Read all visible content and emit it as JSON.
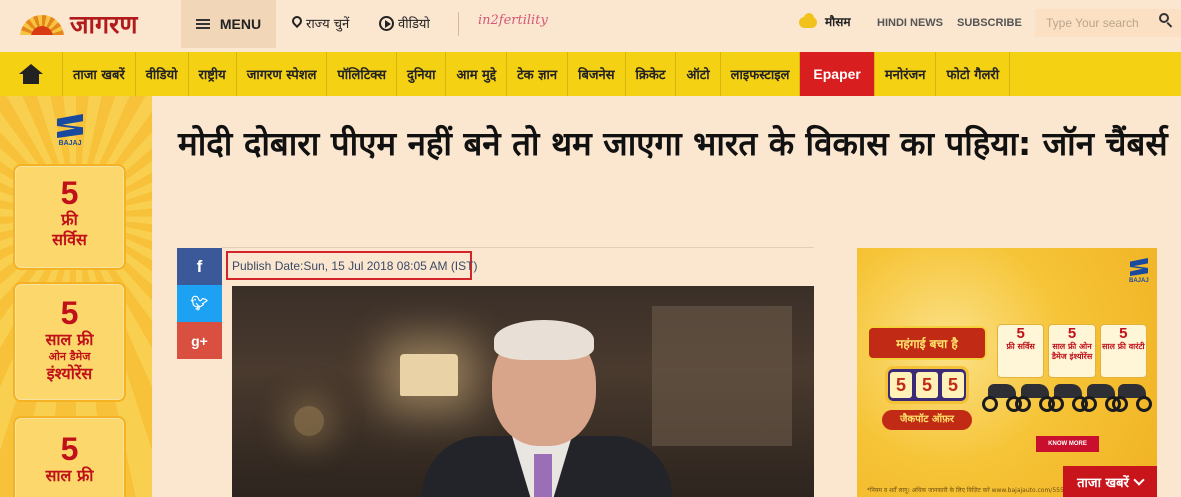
{
  "header": {
    "logo_text": "जागरण",
    "menu_label": "MENU",
    "state_select_label": "राज्य चुनें",
    "video_label": "वीडियो",
    "fertility_brand": "in2fertility",
    "weather_label": "मौसम",
    "hindi_news_label": "HINDI NEWS",
    "subscribe_label": "SUBSCRIBE",
    "search_placeholder": "Type Your search"
  },
  "nav": {
    "items": [
      {
        "label": "ताजा खबरें"
      },
      {
        "label": "वीडियो"
      },
      {
        "label": "राष्ट्रीय"
      },
      {
        "label": "जागरण स्पेशल"
      },
      {
        "label": "पॉलिटिक्स"
      },
      {
        "label": "दुनिया"
      },
      {
        "label": "आम मुद्दे"
      },
      {
        "label": "टेक ज्ञान"
      },
      {
        "label": "बिजनेस"
      },
      {
        "label": "क्रिकेट"
      },
      {
        "label": "ऑटो"
      },
      {
        "label": "लाइफस्टाइल"
      },
      {
        "label": "Epaper"
      },
      {
        "label": "मनोरंजन"
      },
      {
        "label": "फोटो गैलरी"
      }
    ]
  },
  "left_ad": {
    "brand": "BAJAJ",
    "cards": [
      {
        "number": "5",
        "lines": [
          "फ्री",
          "सर्विस"
        ]
      },
      {
        "number": "5",
        "lines": [
          "साल फ्री",
          "ओन डैमेज",
          "इंश्योरेंस"
        ]
      },
      {
        "number": "5",
        "lines": [
          "साल फ्री"
        ]
      }
    ]
  },
  "article": {
    "headline": "मोदी दोबारा पीएम नहीं बने तो थम जाएगा भारत के विकास का पहिया: जॉन चैंबर्स",
    "publish_date": "Publish Date:Sun, 15 Jul 2018 08:05 AM (IST)",
    "share": {
      "facebook": "f",
      "twitter": "t",
      "google_plus": "g+"
    }
  },
  "right_ad": {
    "brand": "BAJAJ",
    "banner_text": "महंगाई बचा है",
    "slot_digits": [
      "5",
      "5",
      "5"
    ],
    "offer_text": "जैकपॉट ऑफ़र",
    "badges": [
      {
        "number": "5",
        "text": "फ्री सर्विस"
      },
      {
        "number": "5",
        "text": "साल फ्री ओन डैमेज इंश्योरेंस"
      },
      {
        "number": "5",
        "text": "साल फ्री वारंटी"
      }
    ],
    "cta": "KNOW MORE",
    "fine_print": "*नियम व शर्तें लागू। अधिक जानकारी के लिए विज़िट करें www.bajajauto.com/555o"
  },
  "latest_news_tab": "ताजा खबरें",
  "colors": {
    "page_bg": "#fbe6cf",
    "nav_bg": "#f5d114",
    "epaper_bg": "#d81e1e",
    "logo_red": "#b11b1b",
    "publish_border": "#d1252a"
  }
}
